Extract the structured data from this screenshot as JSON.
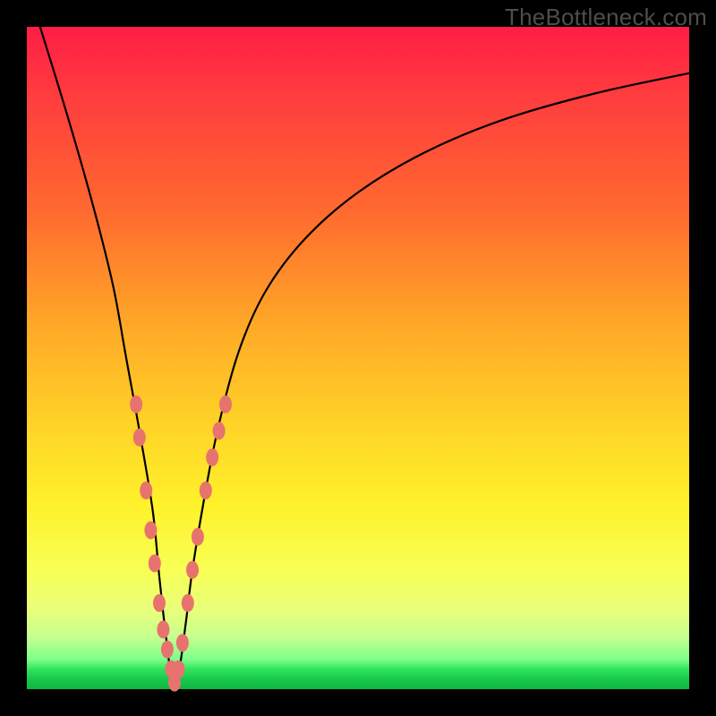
{
  "watermark": "TheBottleneck.com",
  "colors": {
    "frame": "#000000",
    "curve": "#000000",
    "bead": "#e8736e",
    "gradient_top": "#ff1d46",
    "gradient_mid": "#fff12a",
    "gradient_bottom": "#0fb644"
  },
  "chart_data": {
    "type": "line",
    "title": "",
    "xlabel": "",
    "ylabel": "",
    "xlim": [
      0,
      100
    ],
    "ylim": [
      0,
      100
    ],
    "note": "Axes are unlabeled in the image; x and y are normalized 0–100 estimates read from pixel positions. y≈0 corresponds to the green band (bottom), y≈100 to the deep red (top). The curve is a V-shaped bottleneck profile reaching y≈0 near x≈22.",
    "series": [
      {
        "name": "bottleneck-curve",
        "x": [
          2,
          6,
          10,
          13,
          15,
          17,
          19,
          20,
          21,
          22,
          23,
          24,
          25,
          27,
          29,
          32,
          36,
          42,
          50,
          60,
          72,
          86,
          100
        ],
        "y": [
          100,
          87,
          73,
          61,
          50,
          39,
          27,
          17,
          8,
          1,
          3,
          10,
          18,
          30,
          40,
          51,
          60,
          68,
          75,
          81,
          86,
          90,
          93
        ]
      }
    ],
    "markers": {
      "name": "highlighted-points",
      "description": "Salmon-colored bead markers clustered near the curve minimum on both branches.",
      "points": [
        {
          "x": 16.5,
          "y": 43
        },
        {
          "x": 17.0,
          "y": 38
        },
        {
          "x": 18.0,
          "y": 30
        },
        {
          "x": 18.7,
          "y": 24
        },
        {
          "x": 19.3,
          "y": 19
        },
        {
          "x": 20.0,
          "y": 13
        },
        {
          "x": 20.6,
          "y": 9
        },
        {
          "x": 21.2,
          "y": 6
        },
        {
          "x": 21.8,
          "y": 3
        },
        {
          "x": 22.3,
          "y": 1
        },
        {
          "x": 22.9,
          "y": 3
        },
        {
          "x": 23.5,
          "y": 7
        },
        {
          "x": 24.3,
          "y": 13
        },
        {
          "x": 25.0,
          "y": 18
        },
        {
          "x": 25.8,
          "y": 23
        },
        {
          "x": 27.0,
          "y": 30
        },
        {
          "x": 28.0,
          "y": 35
        },
        {
          "x": 29.0,
          "y": 39
        },
        {
          "x": 30.0,
          "y": 43
        }
      ]
    }
  }
}
